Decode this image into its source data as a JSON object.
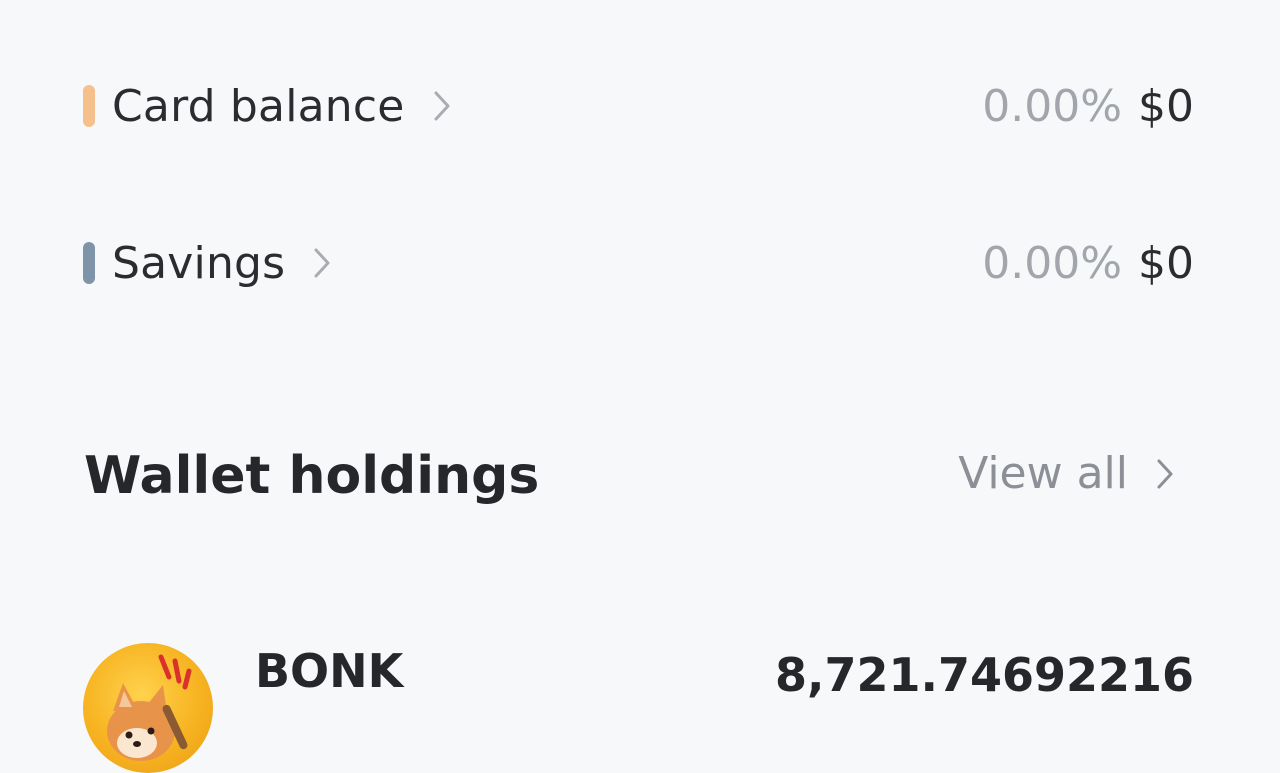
{
  "accounts": [
    {
      "label": "Card balance",
      "percent": "0.00%",
      "amount": "$0",
      "color": "#f6c08c"
    },
    {
      "label": "Savings",
      "percent": "0.00%",
      "amount": "$0",
      "color": "#7e94a8"
    }
  ],
  "wallet": {
    "title": "Wallet holdings",
    "view_all_label": "View all"
  },
  "holdings": [
    {
      "name": "BONK",
      "amount": "8,721.74692216",
      "icon": "bonk-dog-logo"
    }
  ],
  "icons": {
    "chevron": "chevron-right-icon"
  }
}
